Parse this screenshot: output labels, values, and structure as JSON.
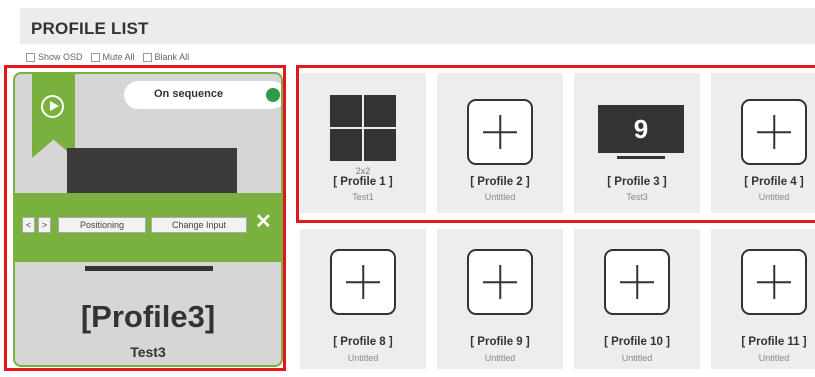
{
  "header": {
    "title": "PROFILE LIST"
  },
  "options": [
    "Show OSD",
    "Mute All",
    "Blank All"
  ],
  "active_profile": {
    "sequence_label": "On sequence",
    "sequence_status_color": "#2b9c48",
    "accent_color": "#7ab03e",
    "controls": {
      "prev": "<",
      "next": ">",
      "positioning": "Positioning",
      "change_input": "Change Input",
      "close": "✕"
    },
    "name": "[Profile3]",
    "subtitle": "Test3"
  },
  "slots": [
    {
      "layout": "2x2",
      "name": "[ Profile 1 ]",
      "subtitle": "Test1",
      "icon": "grid-2x2-icon"
    },
    {
      "layout": "",
      "name": "[ Profile 2 ]",
      "subtitle": "Untitled",
      "icon": "add-icon"
    },
    {
      "layout": "",
      "name": "[ Profile 3 ]",
      "subtitle": "Test3",
      "icon": "monitor-icon",
      "monitor_number": "9"
    },
    {
      "layout": "",
      "name": "[ Profile 4 ]",
      "subtitle": "Untitled",
      "icon": "add-icon"
    },
    {
      "layout": "",
      "name": "[ Profile 8 ]",
      "subtitle": "Untitled",
      "icon": "add-icon"
    },
    {
      "layout": "",
      "name": "[ Profile 9 ]",
      "subtitle": "Untitled",
      "icon": "add-icon"
    },
    {
      "layout": "",
      "name": "[ Profile 10 ]",
      "subtitle": "Untitled",
      "icon": "add-icon"
    },
    {
      "layout": "",
      "name": "[ Profile 11 ]",
      "subtitle": "Untitled",
      "icon": "add-icon"
    }
  ],
  "highlight_color": "#e3161c"
}
